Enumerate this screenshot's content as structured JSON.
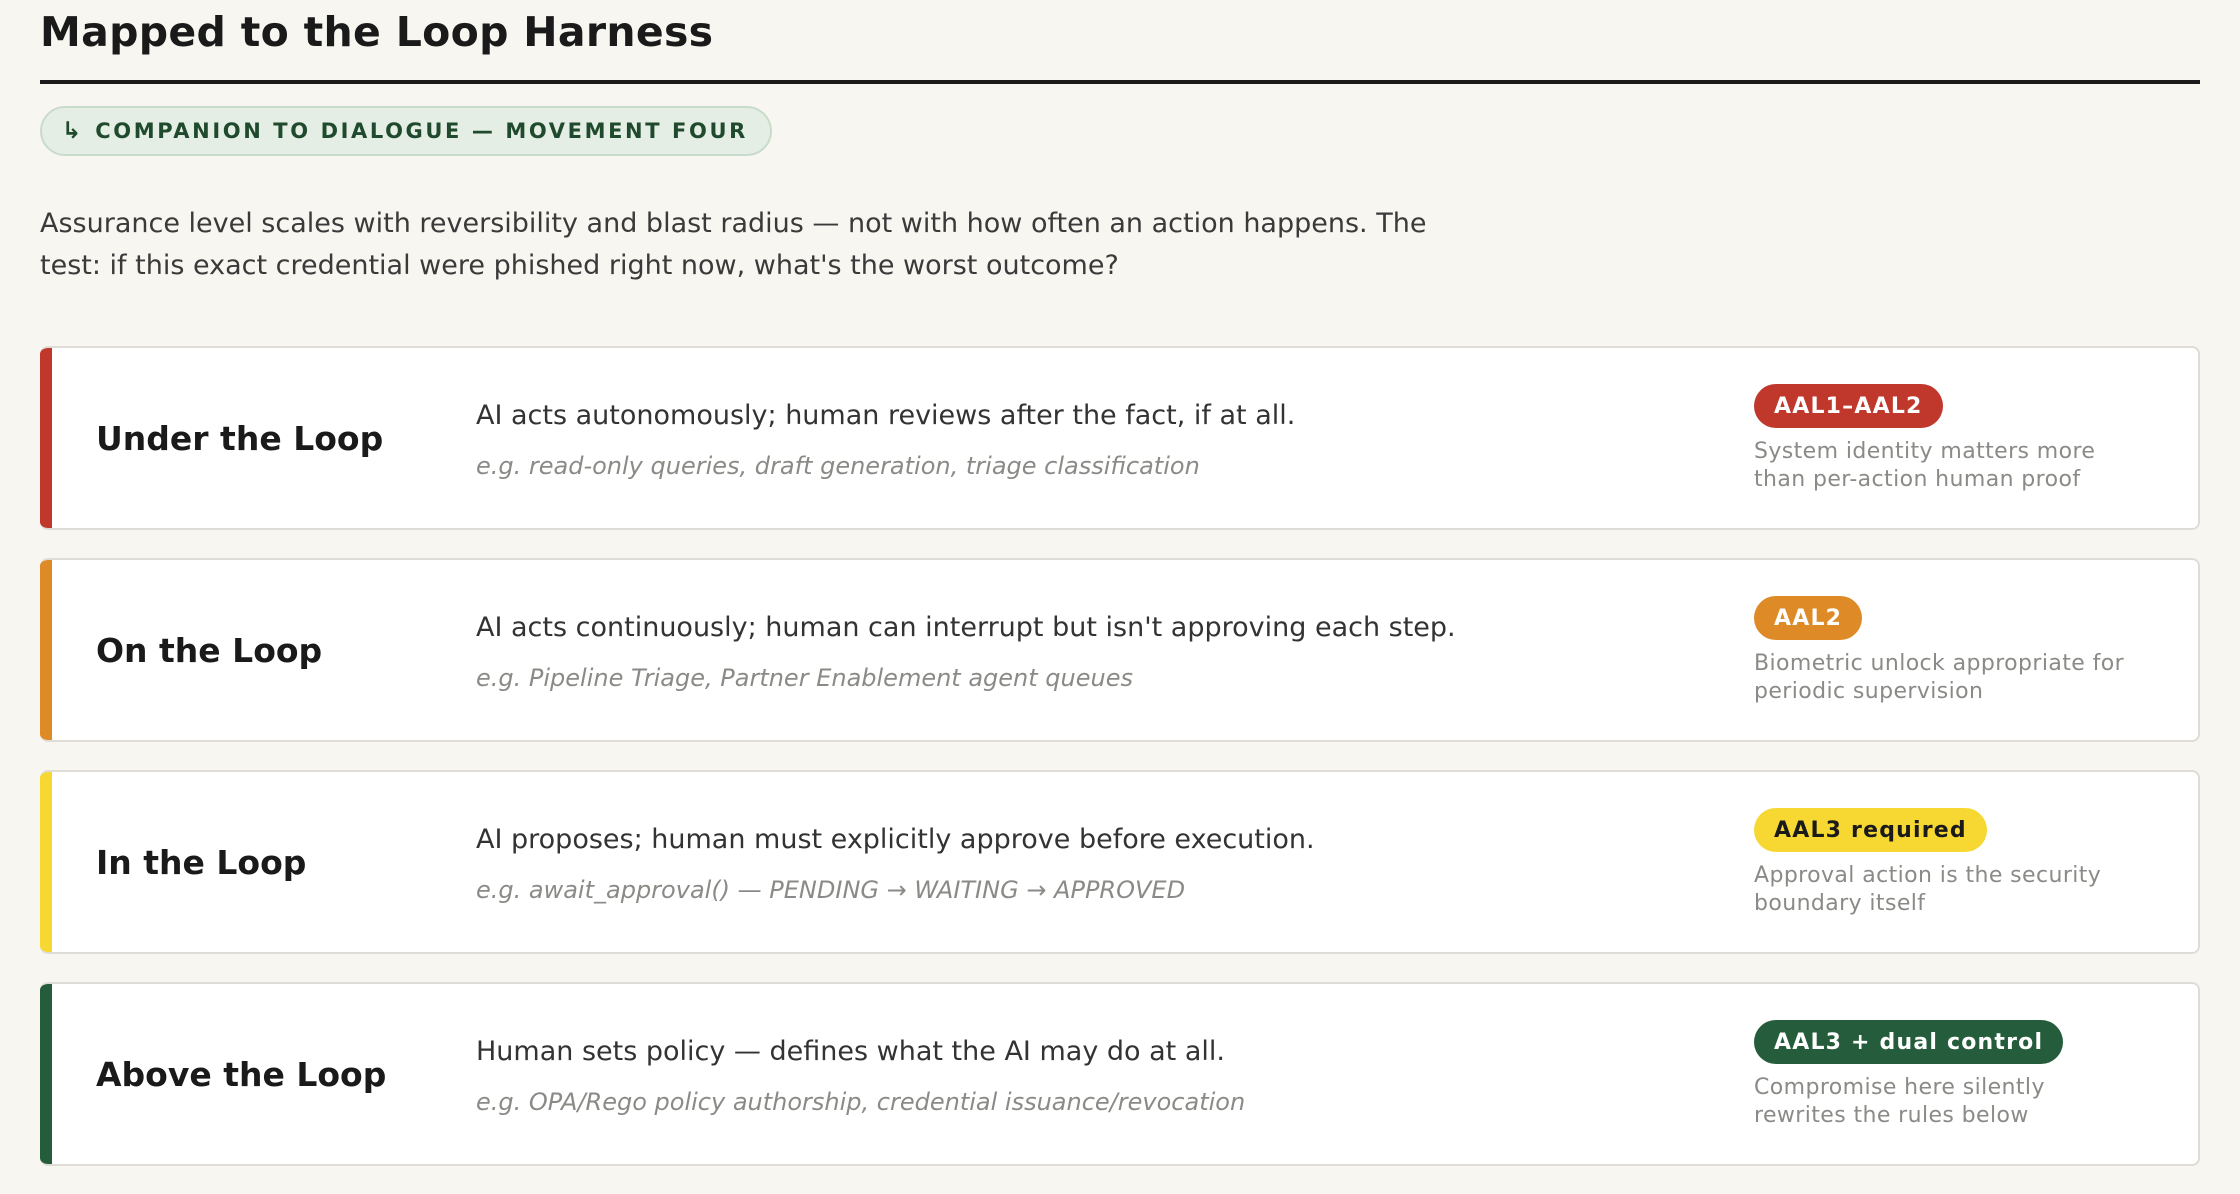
{
  "header": {
    "title": "Mapped to the Loop Harness",
    "pill_icon": "↳",
    "pill_label": "COMPANION TO DIALOGUE — MOVEMENT FOUR"
  },
  "intro": {
    "line1": "Assurance level scales with reversibility and blast radius — not with how often an action happens. The",
    "line2": "test: if this exact credential were phished right now, what's the worst outcome?"
  },
  "rows": [
    {
      "name": "Under the Loop",
      "description": "AI acts autonomously; human reviews after the fact, if at all.",
      "example": "e.g. read-only queries, draft generation, triage classification",
      "badge": "AAL1–AAL2",
      "note_line1": "System identity matters more",
      "note_line2": "than per-action human proof",
      "accent_color": "#c0382b",
      "badge_bg": "#c0382b",
      "badge_fg": "#ffffff"
    },
    {
      "name": "On the Loop",
      "description": "AI acts continuously; human can interrupt but isn't approving each step.",
      "example": "e.g. Pipeline Triage, Partner Enablement agent queues",
      "badge": "AAL2",
      "note_line1": "Biometric unlock appropriate for",
      "note_line2": "periodic supervision",
      "accent_color": "#de8a26",
      "badge_bg": "#de8a26",
      "badge_fg": "#ffffff"
    },
    {
      "name": "In the Loop",
      "description": "AI proposes; human must explicitly approve before execution.",
      "example": "e.g. await_approval() — PENDING → WAITING → APPROVED",
      "badge": "AAL3 required",
      "note_line1": "Approval action is the security",
      "note_line2": "boundary itself",
      "accent_color": "#f7d833",
      "badge_bg": "#f7d833",
      "badge_fg": "#1a1a1a"
    },
    {
      "name": "Above the Loop",
      "description": "Human sets policy — defines what the AI may do at all.",
      "example": "e.g. OPA/Rego policy authorship, credential issuance/revocation",
      "badge": "AAL3 + dual control",
      "note_line1": "Compromise here silently",
      "note_line2": "rewrites the rules below",
      "accent_color": "#255c3b",
      "badge_bg": "#255c3b",
      "badge_fg": "#ffffff"
    }
  ]
}
